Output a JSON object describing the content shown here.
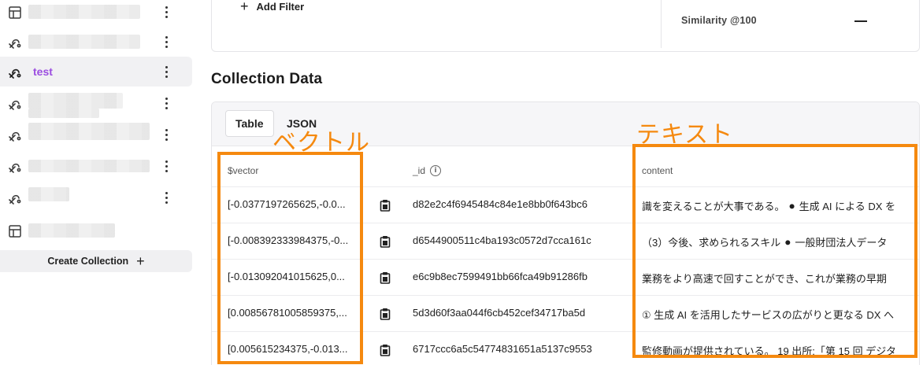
{
  "sidebar": {
    "items": [
      {
        "label": "",
        "icon": "table-icon",
        "active": false
      },
      {
        "label": "",
        "icon": "vector-index-icon",
        "active": false
      },
      {
        "label": "test",
        "icon": "vector-index-icon",
        "active": true
      },
      {
        "label": "",
        "icon": "vector-index-icon",
        "active": false
      },
      {
        "label": "",
        "icon": "vector-index-icon",
        "active": false
      },
      {
        "label": "",
        "icon": "vector-index-icon",
        "active": false
      },
      {
        "label": "",
        "icon": "vector-index-icon",
        "active": false
      },
      {
        "label": "",
        "icon": "table-icon",
        "active": false
      }
    ],
    "create_label": "Create Collection"
  },
  "filter": {
    "add_filter_label": "Add Filter",
    "similarity_label": "Similarity @100",
    "similarity_value": "—"
  },
  "collection": {
    "title": "Collection Data",
    "tabs": [
      {
        "label": "Table",
        "active": true
      },
      {
        "label": "JSON",
        "active": false
      }
    ],
    "columns": [
      "$vector",
      "_id",
      "content"
    ],
    "rows": [
      {
        "vector": "[-0.0377197265625,-0.0...",
        "id": "d82e2c4f6945484c84e1e8bb0f643bc6",
        "content": "識を変えることが大事である。 ⚫ 生成 AI による DX を"
      },
      {
        "vector": "[-0.008392333984375,-0...",
        "id": "d6544900511c4ba193c0572d7cca161c",
        "content": "（3）今後、求められるスキル ⚫ 一般財団法人データ"
      },
      {
        "vector": "[-0.013092041015625,0...",
        "id": "e6c9b8ec7599491bb66fca49b91286fb",
        "content": "業務をより高速で回すことができ、これが業務の早期"
      },
      {
        "vector": "[0.00856781005859375,...",
        "id": "5d3d60f3aa044f6cb452cef34717ba5d",
        "content": "① 生成 AI を活用したサービスの広がりと更なる DX へ"
      },
      {
        "vector": "[0.005615234375,-0.013...",
        "id": "6717ccc6a5c54774831651a5137c9553",
        "content": "監修動画が提供されている。 19 出所:「第 15 回 デジタ"
      }
    ]
  },
  "annotations": {
    "vector_label": "ベクトル",
    "text_label": "テキスト",
    "color": "#f5890f"
  },
  "colors": {
    "accent": "#9b4de0",
    "annotation": "#f5890f"
  }
}
